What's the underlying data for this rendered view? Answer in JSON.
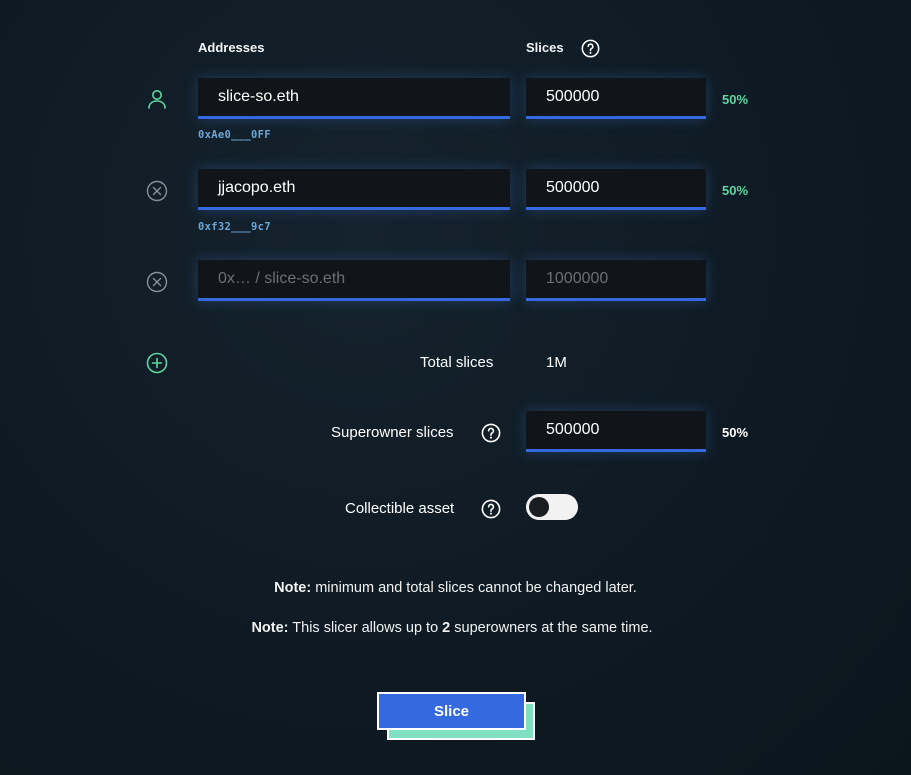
{
  "headers": {
    "addresses": "Addresses",
    "slices": "Slices"
  },
  "rows": [
    {
      "icon": "user-icon",
      "address": "slice-so.eth",
      "resolved": "0xAe0___0FF",
      "slices": "500000",
      "percent": "50%"
    },
    {
      "icon": "remove-circle-icon",
      "address": "jjacopo.eth",
      "resolved": "0xf32___9c7",
      "slices": "500000",
      "percent": "50%"
    },
    {
      "icon": "remove-circle-icon",
      "address_placeholder": "0x… / slice-so.eth",
      "slices_placeholder": "1000000"
    }
  ],
  "total": {
    "label": "Total slices",
    "value": "1M"
  },
  "superowner": {
    "label": "Superowner slices",
    "value": "500000",
    "percent": "50%"
  },
  "collectible": {
    "label": "Collectible asset",
    "enabled": false
  },
  "notes": {
    "note1_bold": "Note:",
    "note1_text": " minimum and total slices cannot be changed later.",
    "note2_bold": "Note:",
    "note2_pre": " This slicer allows up to ",
    "note2_num": "2",
    "note2_post": " superowners at the same time."
  },
  "submit_label": "Slice",
  "colors": {
    "accent_blue": "#3569e0",
    "accent_green": "#5fd6a0",
    "address_blue": "#6aa6d8",
    "background": "#0e1a23"
  }
}
